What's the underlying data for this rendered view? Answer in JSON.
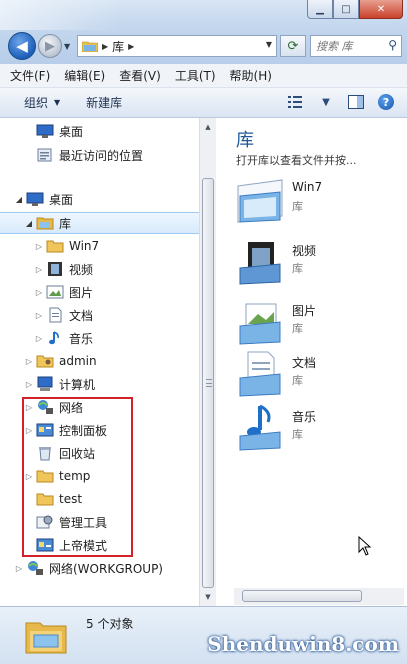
{
  "window": {
    "minimize_glyph": "▁",
    "maximize_glyph": "□",
    "close_glyph": "✕"
  },
  "address_bar": {
    "crumbs": [
      "库"
    ],
    "search_placeholder": "搜索 库"
  },
  "menu": [
    "文件(F)",
    "编辑(E)",
    "查看(V)",
    "工具(T)",
    "帮助(H)"
  ],
  "toolbar": {
    "organize": "组织",
    "new_library": "新建库"
  },
  "nav_tree": [
    {
      "label": "桌面",
      "icon": "desktop-icon",
      "indent": 1,
      "arrow": ""
    },
    {
      "label": "最近访问的位置",
      "icon": "recent-places-icon",
      "indent": 1,
      "arrow": ""
    },
    {
      "label": "桌面",
      "icon": "desktop-icon",
      "indent": 0,
      "arrow": "open"
    },
    {
      "label": "库",
      "icon": "libraries-icon",
      "indent": 1,
      "arrow": "open",
      "selected": true
    },
    {
      "label": "Win7",
      "icon": "folder-icon",
      "indent": 2,
      "arrow": "closed"
    },
    {
      "label": "视频",
      "icon": "video-icon",
      "indent": 2,
      "arrow": "closed"
    },
    {
      "label": "图片",
      "icon": "picture-icon",
      "indent": 2,
      "arrow": "closed"
    },
    {
      "label": "文档",
      "icon": "document-icon",
      "indent": 2,
      "arrow": "closed"
    },
    {
      "label": "音乐",
      "icon": "music-icon",
      "indent": 2,
      "arrow": "closed"
    },
    {
      "label": "admin",
      "icon": "user-folder-icon",
      "indent": 1,
      "arrow": "closed"
    },
    {
      "label": "计算机",
      "icon": "computer-icon",
      "indent": 1,
      "arrow": "closed"
    },
    {
      "label": "网络",
      "icon": "network-icon",
      "indent": 1,
      "arrow": "closed"
    },
    {
      "label": "控制面板",
      "icon": "control-panel-icon",
      "indent": 1,
      "arrow": "closed"
    },
    {
      "label": "回收站",
      "icon": "recycle-bin-icon",
      "indent": 1,
      "arrow": ""
    },
    {
      "label": "temp",
      "icon": "folder-icon",
      "indent": 1,
      "arrow": "closed"
    },
    {
      "label": "test",
      "icon": "folder-icon",
      "indent": 1,
      "arrow": ""
    },
    {
      "label": "管理工具",
      "icon": "admin-tools-icon",
      "indent": 1,
      "arrow": ""
    },
    {
      "label": "上帝模式",
      "icon": "god-mode-icon",
      "indent": 1,
      "arrow": ""
    },
    {
      "label": "网络(WORKGROUP)",
      "icon": "network-icon",
      "indent": 0,
      "arrow": "closed"
    }
  ],
  "content": {
    "title": "库",
    "subtitle": "打开库以查看文件并按...",
    "items": [
      {
        "name": "Win7",
        "type": "库",
        "icon": "library-folder-icon"
      },
      {
        "name": "视频",
        "type": "库",
        "icon": "video-library-icon"
      },
      {
        "name": "图片",
        "type": "库",
        "icon": "picture-library-icon"
      },
      {
        "name": "文档",
        "type": "库",
        "icon": "document-library-icon"
      },
      {
        "name": "音乐",
        "type": "库",
        "icon": "music-library-icon"
      }
    ]
  },
  "status": {
    "count_text": "5 个对象"
  },
  "watermark": "Shenduwin8.com",
  "colors": {
    "accent": "#1e5a9a",
    "highlight_box": "#d3222a",
    "selection": "#d8eafc"
  }
}
